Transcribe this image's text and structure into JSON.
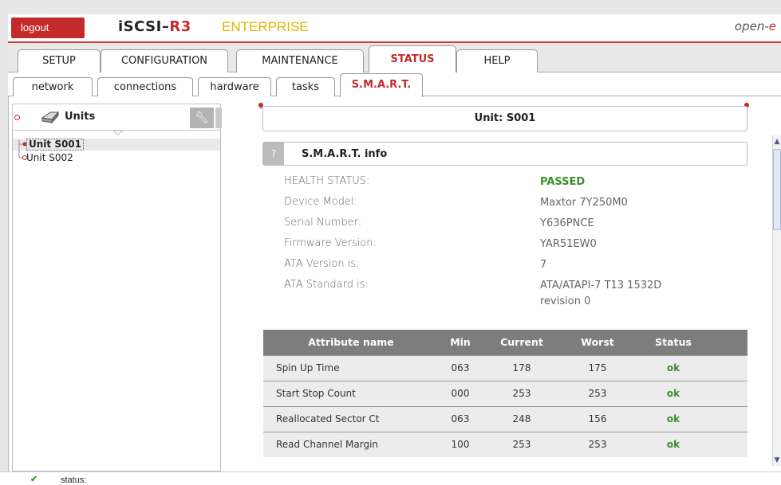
{
  "header": {
    "logout_label": "logout",
    "brand_main": "iSCSI–",
    "brand_r3": "R3",
    "edition": "ENTERPRISE",
    "vendor_prefix": "open-",
    "vendor_suffix": "e"
  },
  "main_tabs": [
    {
      "label": "SETUP",
      "active": false
    },
    {
      "label": "CONFIGURATION",
      "active": false
    },
    {
      "label": "MAINTENANCE",
      "active": false
    },
    {
      "label": "STATUS",
      "active": true
    },
    {
      "label": "HELP",
      "active": false
    }
  ],
  "sub_tabs": [
    {
      "label": "network",
      "active": false
    },
    {
      "label": "connections",
      "active": false
    },
    {
      "label": "hardware",
      "active": false
    },
    {
      "label": "tasks",
      "active": false
    },
    {
      "label": "S.M.A.R.T.",
      "active": true
    }
  ],
  "sidebar": {
    "title": "Units",
    "help": "?",
    "units": [
      {
        "label": "Unit S001",
        "selected": true
      },
      {
        "label": "Unit S002",
        "selected": false
      }
    ]
  },
  "unit_title": "Unit: S001",
  "smart": {
    "help": "?",
    "title": "S.M.A.R.T. info",
    "fields": [
      {
        "label": "HEALTH STATUS:",
        "value": "PASSED"
      },
      {
        "label": "Device Model:",
        "value": "Maxtor 7Y250M0"
      },
      {
        "label": "Serial Number:",
        "value": "Y636PNCE"
      },
      {
        "label": "Firmware Version:",
        "value": "YAR51EW0"
      },
      {
        "label": "ATA Version is:",
        "value": "7"
      },
      {
        "label": "ATA Standard is:",
        "value": "ATA/ATAPI-7 T13 1532D revision 0"
      }
    ]
  },
  "attributes": {
    "headers": [
      "Attribute name",
      "Min",
      "Current",
      "Worst",
      "Status"
    ],
    "rows": [
      [
        "Spin Up Time",
        "063",
        "178",
        "175",
        "ok"
      ],
      [
        "Start Stop Count",
        "000",
        "253",
        "253",
        "ok"
      ],
      [
        "Reallocated Sector Ct",
        "063",
        "248",
        "156",
        "ok"
      ],
      [
        "Read Channel Margin",
        "100",
        "253",
        "253",
        "ok"
      ]
    ]
  },
  "status": {
    "label": "status:",
    "icon": "check-icon"
  },
  "colors": {
    "accent_red": "#c32b2b",
    "edition_yellow": "#e8b200",
    "ok_green": "#3a8f2a",
    "table_header": "#7d7d7d"
  }
}
